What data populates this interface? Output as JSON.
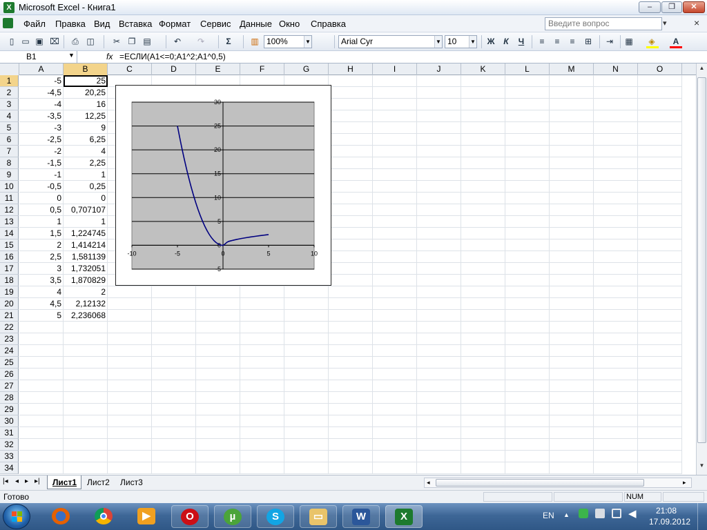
{
  "window": {
    "title": "Microsoft Excel - Книга1",
    "app_icon": "X",
    "min_glyph": "–",
    "restore_glyph": "❐",
    "close_glyph": "✕"
  },
  "menu": {
    "items": [
      "Файл",
      "Правка",
      "Вид",
      "Вставка",
      "Формат",
      "Сервис",
      "Данные",
      "Окно",
      "Справка"
    ],
    "help_placeholder": "Введите вопрос",
    "help_arrow": "▾",
    "doc_close": "×"
  },
  "toolbar": {
    "zoom": "100%",
    "font_name": "Arial Cyr",
    "font_size": "10",
    "bold": "Ж",
    "italic": "К",
    "underline": "Ч",
    "sum": "Σ"
  },
  "formula_bar": {
    "name_box": "B1",
    "fx": "fx",
    "formula": "=ЕСЛИ(A1<=0;A1^2;A1^0,5)"
  },
  "columns": [
    "A",
    "B",
    "C",
    "D",
    "E",
    "F",
    "G",
    "H",
    "I",
    "J",
    "K",
    "L",
    "M",
    "N",
    "O"
  ],
  "rows": [
    "1",
    "2",
    "3",
    "4",
    "5",
    "6",
    "7",
    "8",
    "9",
    "10",
    "11",
    "12",
    "13",
    "14",
    "15",
    "16",
    "17",
    "18",
    "19",
    "20",
    "21",
    "22",
    "23",
    "24",
    "25",
    "26",
    "27",
    "28",
    "29",
    "30",
    "31",
    "32",
    "33",
    "34"
  ],
  "col_a": [
    "-5",
    "-4,5",
    "-4",
    "-3,5",
    "-3",
    "-2,5",
    "-2",
    "-1,5",
    "-1",
    "-0,5",
    "0",
    "0,5",
    "1",
    "1,5",
    "2",
    "2,5",
    "3",
    "3,5",
    "4",
    "4,5",
    "5"
  ],
  "col_b": [
    "25",
    "20,25",
    "16",
    "12,25",
    "9",
    "6,25",
    "4",
    "2,25",
    "1",
    "0,25",
    "0",
    "0,707107",
    "1",
    "1,224745",
    "1,414214",
    "1,581139",
    "1,732051",
    "1,870829",
    "2",
    "2,12132",
    "2,236068"
  ],
  "chart_data": {
    "type": "scatter",
    "x": [
      -5,
      -4.5,
      -4,
      -3.5,
      -3,
      -2.5,
      -2,
      -1.5,
      -1,
      -0.5,
      0,
      0.5,
      1,
      1.5,
      2,
      2.5,
      3,
      3.5,
      4,
      4.5,
      5
    ],
    "y": [
      25,
      20.25,
      16,
      12.25,
      9,
      6.25,
      4,
      2.25,
      1,
      0.25,
      0,
      0.707107,
      1,
      1.224745,
      1.414214,
      1.581139,
      1.732051,
      1.870829,
      2,
      2.12132,
      2.236068
    ],
    "xlim": [
      -10,
      10
    ],
    "ylim": [
      -5,
      30
    ],
    "x_ticks": [
      "-10",
      "-5",
      "0",
      "5",
      "10"
    ],
    "y_ticks": [
      "30",
      "25",
      "20",
      "15",
      "10",
      "5",
      "0",
      "-5"
    ],
    "line_color": "#000080",
    "plot_bg": "#c0c0c0",
    "grid": true,
    "title": "",
    "xlabel": "",
    "ylabel": ""
  },
  "sheet_tabs": [
    "Лист1",
    "Лист2",
    "Лист3"
  ],
  "sheet_nav": [
    "|◂",
    "◂",
    "▸",
    "▸|"
  ],
  "status": {
    "ready": "Готово",
    "num": "NUM"
  },
  "taskbar": {
    "lang": "EN",
    "time": "21:08",
    "date": "17.09.2012",
    "tray_arrow": "▲"
  }
}
